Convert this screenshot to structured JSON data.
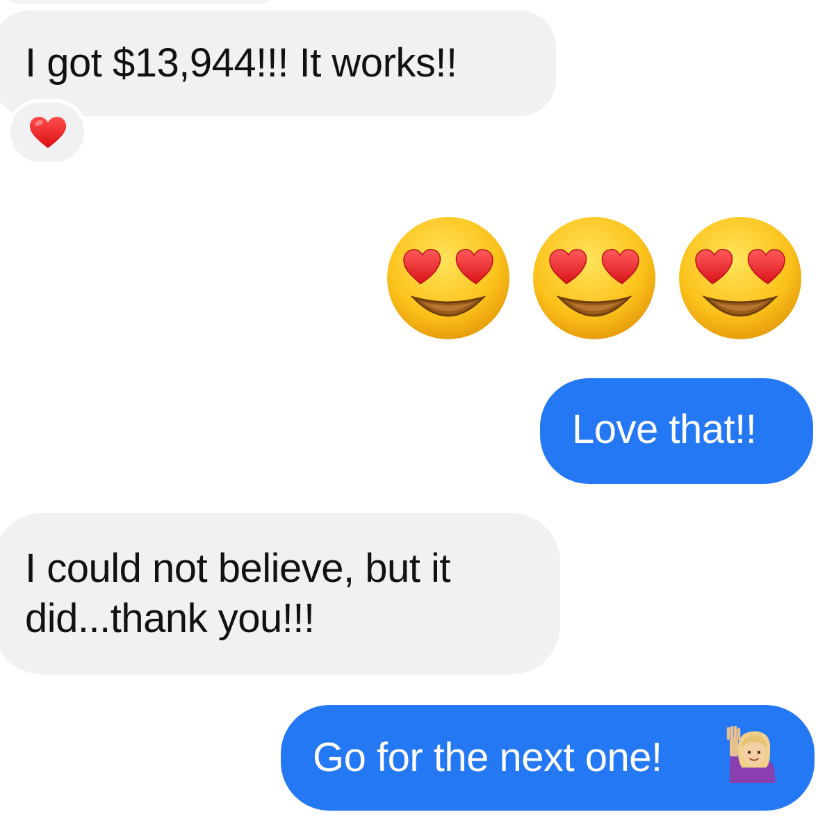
{
  "conversation": {
    "messages": [
      {
        "sender": "other",
        "text": "I got $13,944!!! It works!!",
        "reaction_icon": "red-heart-icon"
      },
      {
        "sender": "me",
        "emoji": "smiling-face-with-heart-eyes-icon",
        "count": 3
      },
      {
        "sender": "me",
        "text": "Love that!!"
      },
      {
        "sender": "other",
        "text_line1": "I could not believe, but it",
        "text_line2": "did...thank you!!!"
      },
      {
        "sender": "me",
        "text": "Go for the next one!",
        "emoji": "person-raising-hand-icon"
      }
    ]
  },
  "colors": {
    "incoming_bubble": "#f1f1f4",
    "outgoing_bubble": "#2478f4",
    "incoming_text": "#111111",
    "outgoing_text": "#ffffff"
  }
}
